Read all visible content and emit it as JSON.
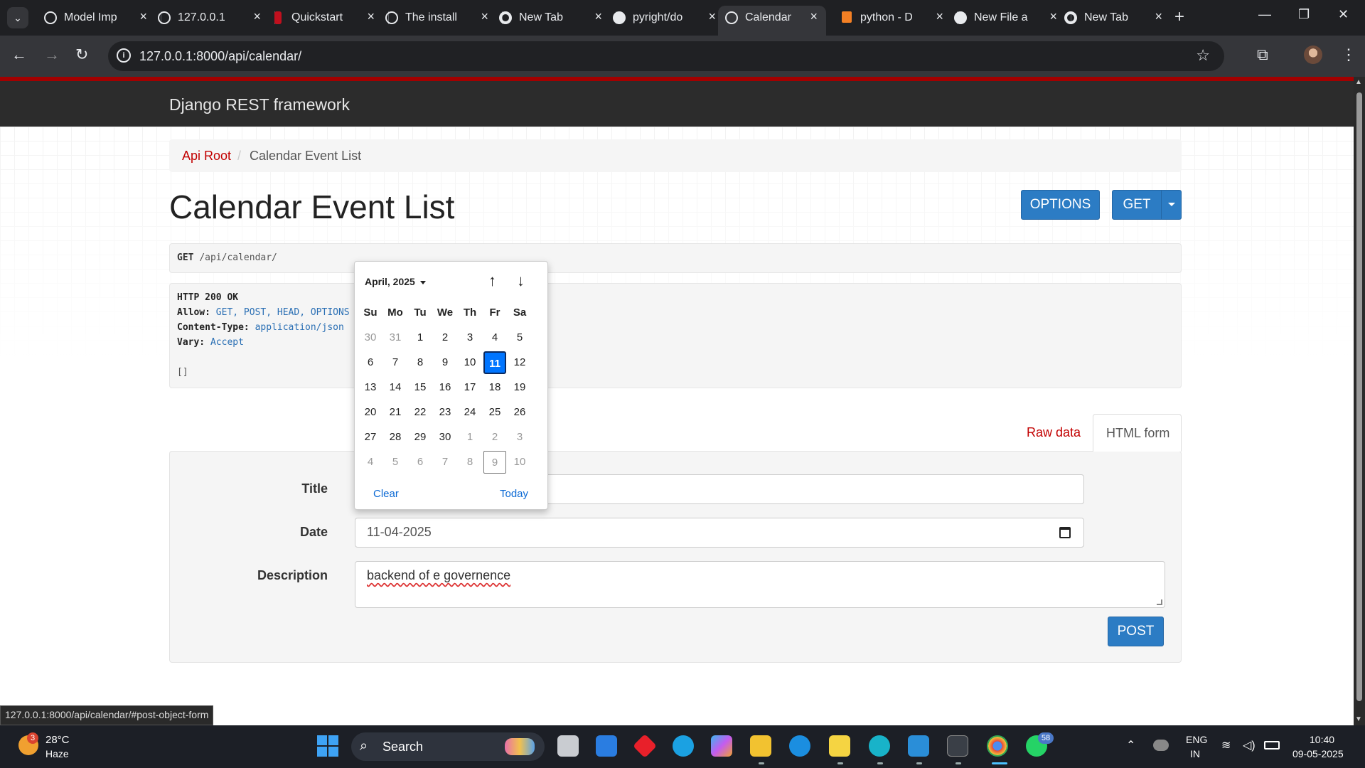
{
  "browser": {
    "tabs": [
      {
        "label": "Model Imp",
        "icon": "openai-icon"
      },
      {
        "label": "127.0.0.1",
        "icon": "globe-icon"
      },
      {
        "label": "Quickstart",
        "icon": "quickstart-icon"
      },
      {
        "label": "The install",
        "icon": "globe-icon"
      },
      {
        "label": "New Tab",
        "icon": "chrome-icon"
      },
      {
        "label": "pyright/do",
        "icon": "github-icon"
      },
      {
        "label": "Calendar E",
        "icon": "globe-icon",
        "active": true
      },
      {
        "label": "python - D",
        "icon": "stackoverflow-icon"
      },
      {
        "label": "New File a",
        "icon": "github-icon"
      },
      {
        "label": "New Tab",
        "icon": "chrome-icon"
      }
    ],
    "url": "127.0.0.1:8000/api/calendar/",
    "status_url": "127.0.0.1:8000/api/calendar/#post-object-form"
  },
  "app": {
    "brand": "Django REST framework",
    "breadcrumb": {
      "root": "Api Root",
      "sep": "/",
      "current": "Calendar Event List"
    },
    "title": "Calendar Event List",
    "buttons": {
      "options": "OPTIONS",
      "get": "GET",
      "post": "POST"
    },
    "request": {
      "method": "GET",
      "path": "/api/calendar/"
    },
    "response": {
      "status": "HTTP 200 OK",
      "allow_key": "Allow:",
      "allow_val": "GET, POST, HEAD, OPTIONS",
      "ctype_key": "Content-Type:",
      "ctype_val": "application/json",
      "vary_key": "Vary:",
      "vary_val": "Accept",
      "body": "[]"
    },
    "form_tabs": {
      "raw": "Raw data",
      "html": "HTML form"
    },
    "form": {
      "title_label": "Title",
      "title_value": "",
      "date_label": "Date",
      "date_value": "11-04-2025",
      "desc_label": "Description",
      "desc_value": "backend of e governence"
    }
  },
  "datepicker": {
    "month": "April, 2025",
    "weekdays": [
      "Su",
      "Mo",
      "Tu",
      "We",
      "Th",
      "Fr",
      "Sa"
    ],
    "weeks": [
      [
        "30",
        "31",
        "1",
        "2",
        "3",
        "4",
        "5"
      ],
      [
        "6",
        "7",
        "8",
        "9",
        "10",
        "11",
        "12"
      ],
      [
        "13",
        "14",
        "15",
        "16",
        "17",
        "18",
        "19"
      ],
      [
        "20",
        "21",
        "22",
        "23",
        "24",
        "25",
        "26"
      ],
      [
        "27",
        "28",
        "29",
        "30",
        "1",
        "2",
        "3"
      ],
      [
        "4",
        "5",
        "6",
        "7",
        "8",
        "9",
        "10"
      ]
    ],
    "selected": "11",
    "clear": "Clear",
    "today": "Today"
  },
  "taskbar": {
    "weather_badge": "3",
    "temp": "28°C",
    "condition": "Haze",
    "search": "Search",
    "whatsapp_badge": "58",
    "lang1": "ENG",
    "lang2": "IN",
    "time": "10:40",
    "date": "09-05-2025"
  },
  "colors": {
    "accent": "#2c7cc4",
    "brand_red": "#a30000",
    "link_red": "#c20000",
    "selected_day": "#0075ff"
  }
}
